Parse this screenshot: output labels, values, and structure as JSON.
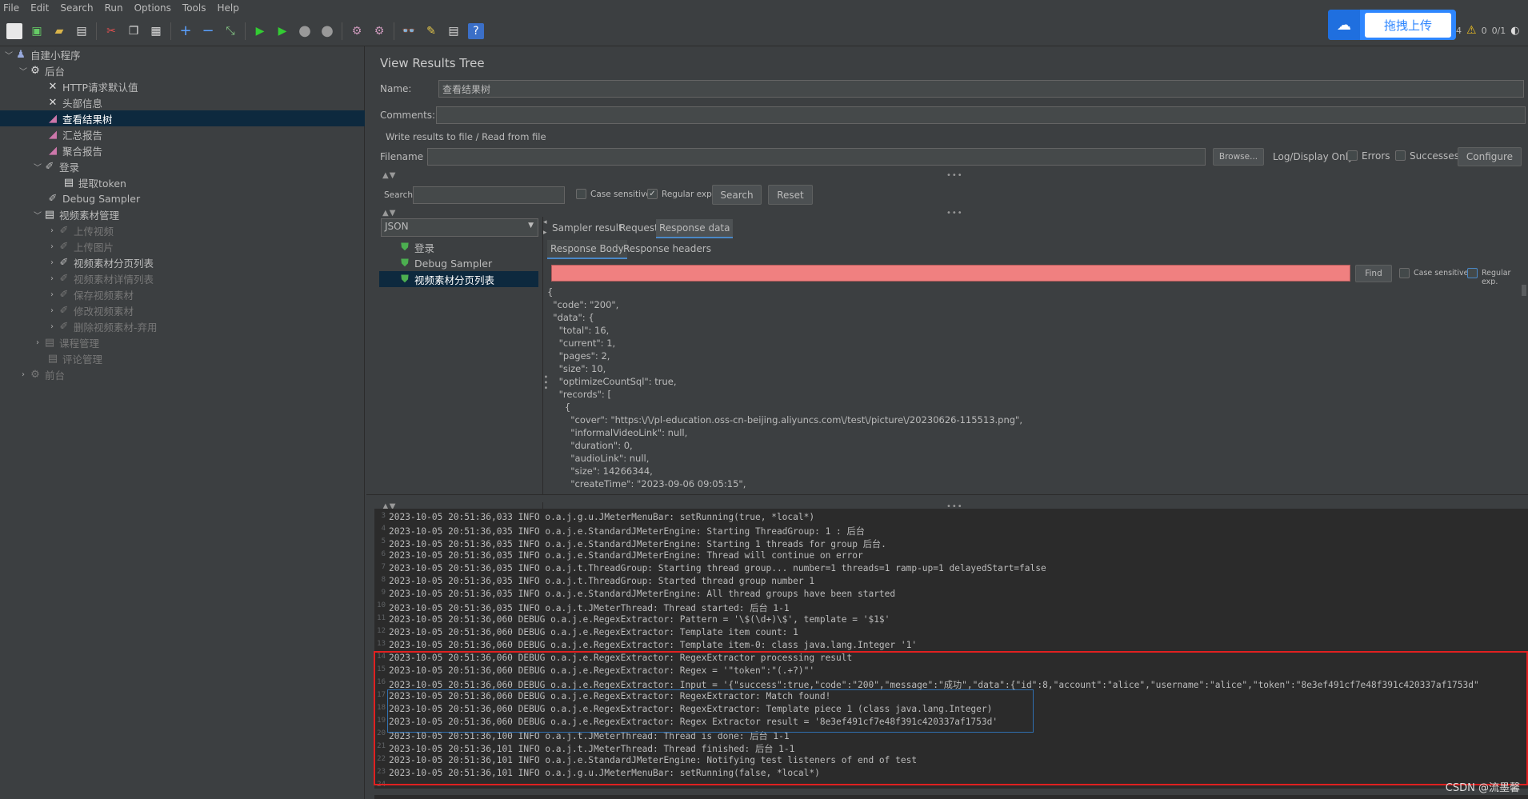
{
  "menu": [
    "File",
    "Edit",
    "Search",
    "Run",
    "Options",
    "Tools",
    "Help"
  ],
  "upload": {
    "label": "拖拽上传"
  },
  "top_status": {
    "count": "4",
    "ratio": "0/1",
    "zero": "0"
  },
  "tree": [
    {
      "label": "自建小程序"
    },
    {
      "label": "后台"
    },
    {
      "label": "HTTP请求默认值"
    },
    {
      "label": "头部信息"
    },
    {
      "label": "查看结果树"
    },
    {
      "label": "汇总报告"
    },
    {
      "label": "聚合报告"
    },
    {
      "label": "登录"
    },
    {
      "label": "提取token"
    },
    {
      "label": "Debug Sampler"
    },
    {
      "label": "视频素材管理"
    },
    {
      "label": "上传视频"
    },
    {
      "label": "上传图片"
    },
    {
      "label": "视频素材分页列表"
    },
    {
      "label": "视频素材详情列表"
    },
    {
      "label": "保存视频素材"
    },
    {
      "label": "修改视频素材"
    },
    {
      "label": "删除视频素材-弃用"
    },
    {
      "label": "课程管理"
    },
    {
      "label": "评论管理"
    },
    {
      "label": "前台"
    }
  ],
  "panel": {
    "title": "View Results Tree",
    "name_label": "Name:",
    "name_value": "查看结果树",
    "comments_label": "Comments:",
    "write_results": "Write results to file / Read from file",
    "filename_label": "Filename",
    "browse": "Browse...",
    "log_display": "Log/Display Only:",
    "errors": "Errors",
    "successes": "Successes",
    "configure": "Configure",
    "search_label": "Search:",
    "case_sensitive": "Case sensitive",
    "regular_exp": "Regular exp.",
    "search_btn": "Search",
    "reset_btn": "Reset",
    "renderer": "JSON",
    "results": [
      "登录",
      "Debug Sampler",
      "视频素材分页列表"
    ],
    "tabs": [
      "Sampler result",
      "Request",
      "Response data"
    ],
    "subtabs": [
      "Response Body",
      "Response headers"
    ],
    "find": "Find",
    "case_sensitive2": "Case sensitive",
    "regular_exp2": "Regular exp."
  },
  "json_lines": [
    "{",
    "  \"code\": \"200\",",
    "  \"data\": {",
    "    \"total\": 16,",
    "    \"current\": 1,",
    "    \"pages\": 2,",
    "    \"size\": 10,",
    "    \"optimizeCountSql\": true,",
    "    \"records\": [",
    "      {",
    "        \"cover\": \"https:\\/\\/pl-education.oss-cn-beijing.aliyuncs.com\\/test\\/picture\\/20230626-115513.png\",",
    "        \"informalVideoLink\": null,",
    "        \"duration\": 0,",
    "        \"audioLink\": null,",
    "        \"size\": 14266344,",
    "        \"createTime\": \"2023-09-06 09:05:15\","
  ],
  "log": [
    {
      "n": "3",
      "t": "2023-10-05 20:51:36,033 INFO o.a.j.g.u.JMeterMenuBar: setRunning(true, *local*)"
    },
    {
      "n": "4",
      "t": "2023-10-05 20:51:36,035 INFO o.a.j.e.StandardJMeterEngine: Starting ThreadGroup: 1 : 后台"
    },
    {
      "n": "5",
      "t": "2023-10-05 20:51:36,035 INFO o.a.j.e.StandardJMeterEngine: Starting 1 threads for group 后台."
    },
    {
      "n": "6",
      "t": "2023-10-05 20:51:36,035 INFO o.a.j.e.StandardJMeterEngine: Thread will continue on error"
    },
    {
      "n": "7",
      "t": "2023-10-05 20:51:36,035 INFO o.a.j.t.ThreadGroup: Starting thread group... number=1 threads=1 ramp-up=1 delayedStart=false"
    },
    {
      "n": "8",
      "t": "2023-10-05 20:51:36,035 INFO o.a.j.t.ThreadGroup: Started thread group number 1"
    },
    {
      "n": "9",
      "t": "2023-10-05 20:51:36,035 INFO o.a.j.e.StandardJMeterEngine: All thread groups have been started"
    },
    {
      "n": "10",
      "t": "2023-10-05 20:51:36,035 INFO o.a.j.t.JMeterThread: Thread started: 后台 1-1"
    },
    {
      "n": "11",
      "t": "2023-10-05 20:51:36,060 DEBUG o.a.j.e.RegexExtractor: Pattern = '\\$(\\d+)\\$', template = '$1$'"
    },
    {
      "n": "12",
      "t": "2023-10-05 20:51:36,060 DEBUG o.a.j.e.RegexExtractor: Template item count: 1"
    },
    {
      "n": "13",
      "t": "2023-10-05 20:51:36,060 DEBUG o.a.j.e.RegexExtractor: Template item-0: class java.lang.Integer '1'"
    },
    {
      "n": "14",
      "t": "2023-10-05 20:51:36,060 DEBUG o.a.j.e.RegexExtractor: RegexExtractor processing result"
    },
    {
      "n": "15",
      "t": "2023-10-05 20:51:36,060 DEBUG o.a.j.e.RegexExtractor: Regex = '\"token\":\"(.+?)\"'"
    },
    {
      "n": "16",
      "t": "2023-10-05 20:51:36,060 DEBUG o.a.j.e.RegexExtractor: Input = '{\"success\":true,\"code\":\"200\",\"message\":\"成功\",\"data\":{\"id\":8,\"account\":\"alice\",\"username\":\"alice\",\"token\":\"8e3ef491cf7e48f391c420337af1753d\""
    },
    {
      "n": "17",
      "t": "2023-10-05 20:51:36,060 DEBUG o.a.j.e.RegexExtractor: RegexExtractor: Match found!"
    },
    {
      "n": "18",
      "t": "2023-10-05 20:51:36,060 DEBUG o.a.j.e.RegexExtractor: RegexExtractor: Template piece 1 (class java.lang.Integer)"
    },
    {
      "n": "19",
      "t": "2023-10-05 20:51:36,060 DEBUG o.a.j.e.RegexExtractor: Regex Extractor result = '8e3ef491cf7e48f391c420337af1753d'"
    },
    {
      "n": "20",
      "t": "2023-10-05 20:51:36,100 INFO o.a.j.t.JMeterThread: Thread is done: 后台 1-1"
    },
    {
      "n": "21",
      "t": "2023-10-05 20:51:36,101 INFO o.a.j.t.JMeterThread: Thread finished: 后台 1-1"
    },
    {
      "n": "22",
      "t": "2023-10-05 20:51:36,101 INFO o.a.j.e.StandardJMeterEngine: Notifying test listeners of end of test"
    },
    {
      "n": "23",
      "t": "2023-10-05 20:51:36,101 INFO o.a.j.g.u.JMeterMenuBar: setRunning(false, *local*)"
    },
    {
      "n": "24",
      "t": ""
    }
  ],
  "watermark": "CSDN @流墨馨",
  "colors": {
    "bg": "#3c3f41",
    "selected": "#0d293e",
    "log_bg": "#2b2b2b",
    "highlight_red": "#e02020",
    "highlight_blue": "#2f6fb0",
    "find_field": "#f08080"
  }
}
